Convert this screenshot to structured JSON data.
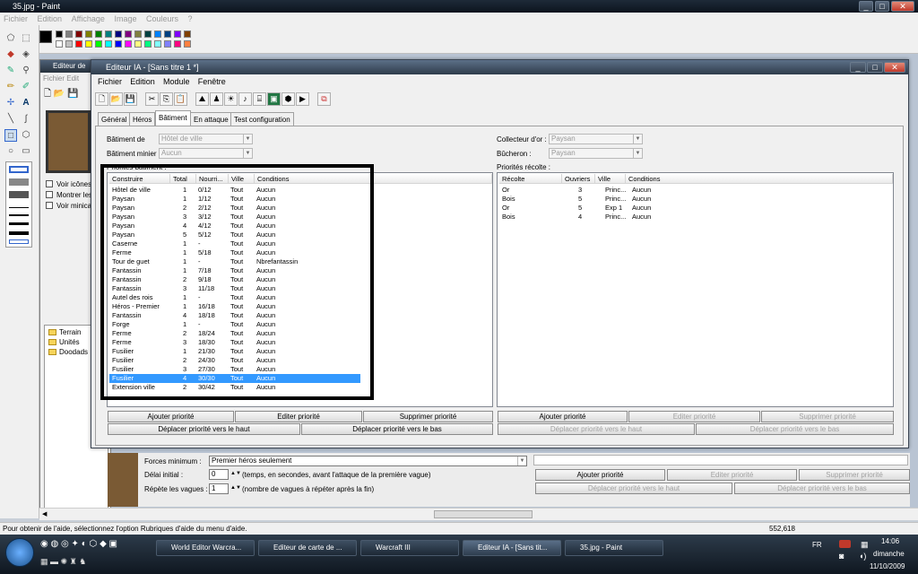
{
  "paint": {
    "title": "35.jpg - Paint",
    "menu": [
      "Fichier",
      "Edition",
      "Affichage",
      "Image",
      "Couleurs",
      "?"
    ],
    "coords": "552,618",
    "status": "Pour obtenir de l'aide, sélectionnez l'option Rubriques d'aide du menu d'aide."
  },
  "palette": [
    "#000000",
    "#808080",
    "#800000",
    "#808000",
    "#008000",
    "#008080",
    "#000080",
    "#800080",
    "#808040",
    "#004040",
    "#0080ff",
    "#004080",
    "#8000ff",
    "#804000",
    "#ffffff",
    "#c0c0c0",
    "#ff0000",
    "#ffff00",
    "#00ff00",
    "#00ffff",
    "#0000ff",
    "#ff00ff",
    "#ffff80",
    "#00ff80",
    "#80ffff",
    "#8080ff",
    "#ff0080",
    "#ff8040"
  ],
  "bg_editor": {
    "title": "Editeur de",
    "menu": [
      "Fichier",
      "Edit"
    ],
    "checks": [
      "Voir icônes",
      "Montrer les",
      "Voir minica"
    ],
    "tree": [
      "Terrain",
      "Unités",
      "Doodads"
    ]
  },
  "bottom": {
    "forces_label": "Forces minimum :",
    "forces_value": "Premier héros seulement",
    "delay_label": "Délai initial :",
    "delay_value": "0",
    "delay_note": "(temps, en secondes, avant l'attaque de la première vague)",
    "repeat_label": "Répète les vagues :",
    "repeat_value": "1",
    "repeat_note": "(nombre de vagues à répéter après la fin)",
    "btn_add": "Ajouter priorité",
    "btn_edit": "Editer priorité",
    "btn_del": "Supprimer priorité",
    "btn_up": "Déplacer priorité vers le haut",
    "btn_down": "Déplacer priorité vers le bas"
  },
  "ai": {
    "title": "Editeur IA - [Sans titre 1 *]",
    "menu": [
      "Fichier",
      "Edition",
      "Module",
      "Fenêtre"
    ],
    "tabs": [
      "Général",
      "Héros",
      "Bâtiment",
      "En attaque",
      "Test configuration"
    ],
    "batiment_de_label": "Bâtiment de",
    "batiment_de_value": "Hôtel de ville",
    "batiment_minier_label": "Bâtiment minier :",
    "batiment_minier_value": "Aucun",
    "collecteur_label": "Collecteur d'or :",
    "collecteur_value": "Paysan",
    "bucheron_label": "Bûcheron :",
    "bucheron_value": "Paysan",
    "prio_bat_label": "Priorités bâtiment :",
    "prio_rec_label": "Priorités récolte :",
    "bat_headers": [
      "Construire",
      "Total",
      "Nourri...",
      "Ville",
      "Conditions"
    ],
    "bat_rows": [
      [
        "Hôtel de ville",
        "1",
        "0/12",
        "Tout",
        "Aucun"
      ],
      [
        "Paysan",
        "1",
        "1/12",
        "Tout",
        "Aucun"
      ],
      [
        "Paysan",
        "2",
        "2/12",
        "Tout",
        "Aucun"
      ],
      [
        "Paysan",
        "3",
        "3/12",
        "Tout",
        "Aucun"
      ],
      [
        "Paysan",
        "4",
        "4/12",
        "Tout",
        "Aucun"
      ],
      [
        "Paysan",
        "5",
        "5/12",
        "Tout",
        "Aucun"
      ],
      [
        "Caserne",
        "1",
        "-",
        "Tout",
        "Aucun"
      ],
      [
        "Ferme",
        "1",
        "5/18",
        "Tout",
        "Aucun"
      ],
      [
        "Tour de guet",
        "1",
        "-",
        "Tout",
        "Nbrefantassin"
      ],
      [
        "Fantassin",
        "1",
        "7/18",
        "Tout",
        "Aucun"
      ],
      [
        "Fantassin",
        "2",
        "9/18",
        "Tout",
        "Aucun"
      ],
      [
        "Fantassin",
        "3",
        "11/18",
        "Tout",
        "Aucun"
      ],
      [
        "Autel des rois",
        "1",
        "-",
        "Tout",
        "Aucun"
      ],
      [
        "Héros - Premier",
        "1",
        "16/18",
        "Tout",
        "Aucun"
      ],
      [
        "Fantassin",
        "4",
        "18/18",
        "Tout",
        "Aucun"
      ],
      [
        "Forge",
        "1",
        "-",
        "Tout",
        "Aucun"
      ],
      [
        "Ferme",
        "2",
        "18/24",
        "Tout",
        "Aucun"
      ],
      [
        "Ferme",
        "3",
        "18/30",
        "Tout",
        "Aucun"
      ],
      [
        "Fusilier",
        "1",
        "21/30",
        "Tout",
        "Aucun"
      ],
      [
        "Fusilier",
        "2",
        "24/30",
        "Tout",
        "Aucun"
      ],
      [
        "Fusilier",
        "3",
        "27/30",
        "Tout",
        "Aucun"
      ],
      [
        "Fusilier",
        "4",
        "30/30",
        "Tout",
        "Aucun"
      ],
      [
        "Extension ville",
        "2",
        "30/42",
        "Tout",
        "Aucun"
      ]
    ],
    "selected_row": 21,
    "rec_headers": [
      "Récolte",
      "Ouvriers",
      "Ville",
      "Conditions"
    ],
    "rec_rows": [
      [
        "Or",
        "3",
        "Princ...",
        "Aucun"
      ],
      [
        "Bois",
        "5",
        "Princ...",
        "Aucun"
      ],
      [
        "Or",
        "5",
        "Exp 1",
        "Aucun"
      ],
      [
        "Bois",
        "4",
        "Princ...",
        "Aucun"
      ]
    ],
    "btn_add": "Ajouter priorité",
    "btn_edit": "Editer priorité",
    "btn_del": "Supprimer priorité",
    "btn_up": "Déplacer priorité vers le haut",
    "btn_down": "Déplacer priorité vers le bas"
  },
  "taskbar": {
    "items": [
      "World Editor Warcra...",
      "Editeur de carte de ...",
      "Warcraft III",
      "Editeur IA - [Sans tit...",
      "35.jpg - Paint"
    ],
    "lang": "FR",
    "time": "14:06",
    "day": "dimanche",
    "date": "11/10/2009"
  }
}
